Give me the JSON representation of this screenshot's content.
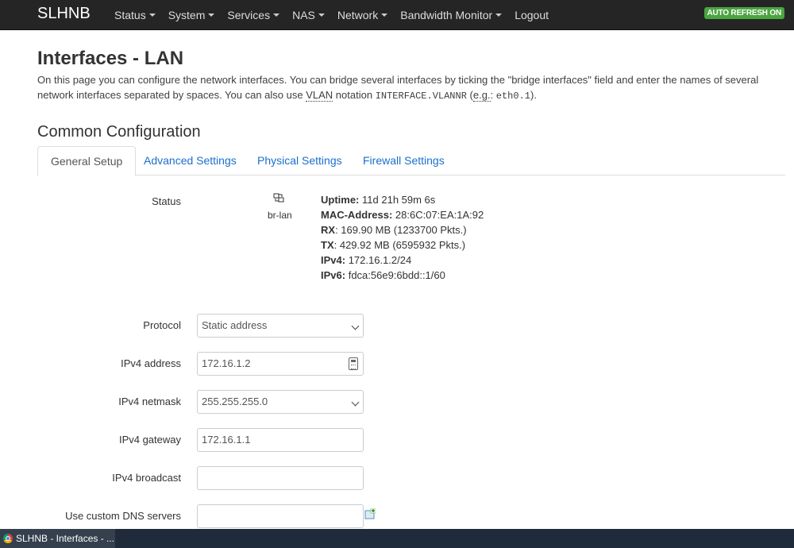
{
  "navbar": {
    "brand": "SLHNB",
    "menu": [
      {
        "label": "Status",
        "dropdown": true
      },
      {
        "label": "System",
        "dropdown": true
      },
      {
        "label": "Services",
        "dropdown": true
      },
      {
        "label": "NAS",
        "dropdown": true
      },
      {
        "label": "Network",
        "dropdown": true
      },
      {
        "label": "Bandwidth Monitor",
        "dropdown": true
      },
      {
        "label": "Logout",
        "dropdown": false
      }
    ],
    "auto_refresh": "AUTO REFRESH ON",
    "auto_refresh_color": "#4aa540"
  },
  "page": {
    "title": "Interfaces - LAN",
    "desc_part1": "On this page you can configure the network interfaces. You can bridge several interfaces by ticking the \"bridge interfaces\" field and enter the names of several network interfaces separated by spaces. You can also use ",
    "desc_vlan": "VLAN",
    "desc_part2": " notation ",
    "desc_code1": "INTERFACE.VLANNR",
    "desc_part3": " (",
    "desc_eg": "e.g.",
    "desc_part4": ": ",
    "desc_code2": "eth0.1",
    "desc_part5": ")."
  },
  "section": {
    "title": "Common Configuration",
    "tabs": [
      "General Setup",
      "Advanced Settings",
      "Physical Settings",
      "Firewall Settings"
    ],
    "active_tab": "General Setup"
  },
  "status": {
    "label": "Status",
    "interface": "br-lan",
    "icon": "bridge-interface-icon",
    "uptime_label": "Uptime:",
    "uptime": "11d 21h 59m 6s",
    "mac_label": "MAC-Address:",
    "mac": "28:6C:07:EA:1A:92",
    "rx_label": "RX",
    "rx": ": 169.90 MB (1233700 Pkts.)",
    "tx_label": "TX",
    "tx": ": 429.92 MB (6595932 Pkts.)",
    "ipv4_label": "IPv4:",
    "ipv4": "172.16.1.2/24",
    "ipv6_label": "IPv6:",
    "ipv6": "fdca:56e9:6bdd::1/60"
  },
  "form": {
    "protocol": {
      "label": "Protocol",
      "value": "Static address"
    },
    "ipv4_address": {
      "label": "IPv4 address",
      "value": "172.16.1.2"
    },
    "ipv4_netmask": {
      "label": "IPv4 netmask",
      "value": "255.255.255.0"
    },
    "ipv4_gateway": {
      "label": "IPv4 gateway",
      "value": "172.16.1.1"
    },
    "ipv4_broadcast": {
      "label": "IPv4 broadcast",
      "value": ""
    },
    "dns": {
      "label": "Use custom DNS servers",
      "value": ""
    }
  },
  "taskbar": {
    "item": "SLHNB - Interfaces - ..."
  }
}
